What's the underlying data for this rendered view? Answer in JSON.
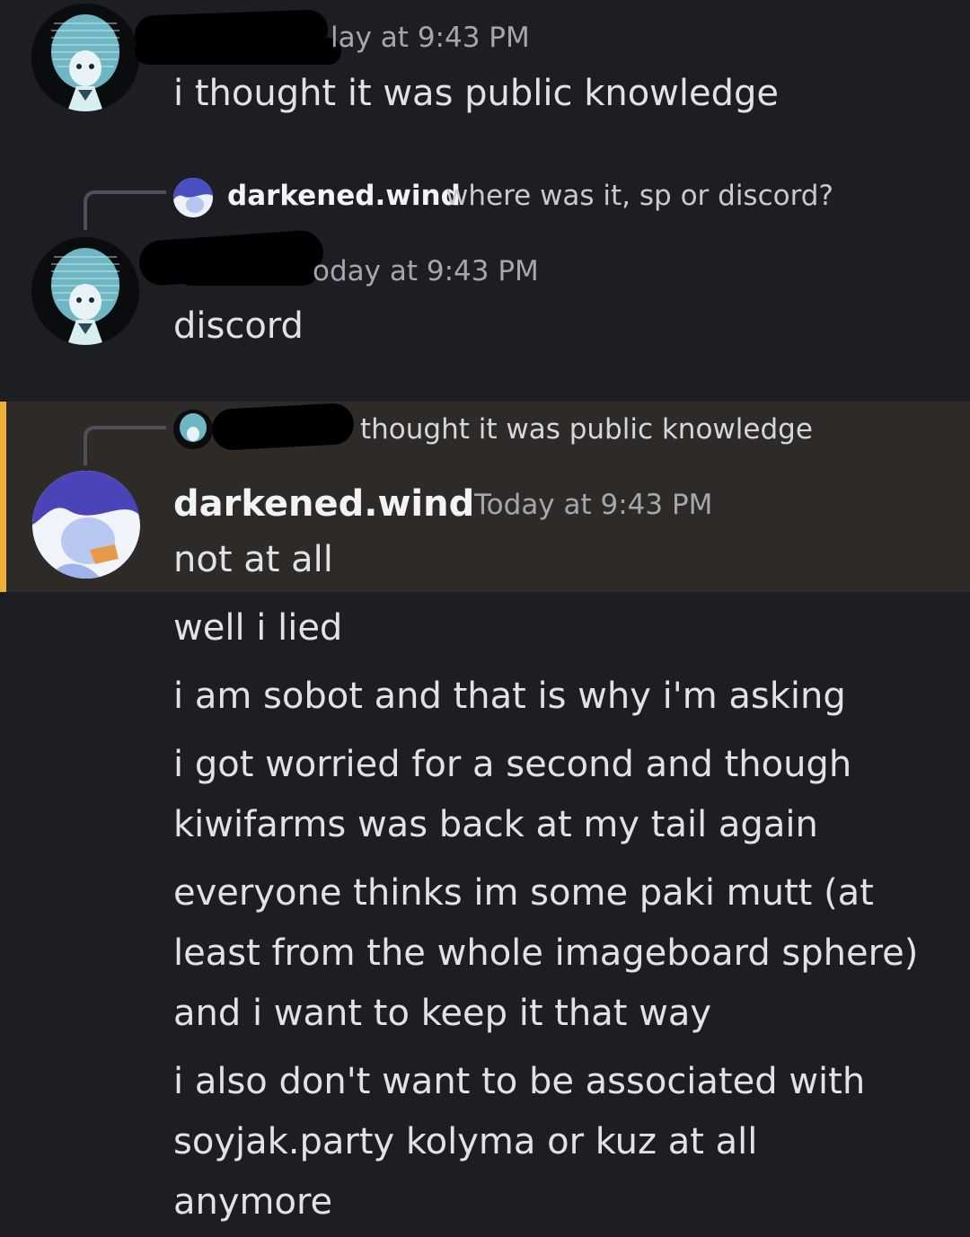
{
  "messages": [
    {
      "timestamp_partial": "lay at 9:43 PM",
      "text": "i thought it was public knowledge"
    },
    {
      "reply_to": {
        "username": "darkened.wind",
        "text": "where was it, sp or discord?"
      },
      "timestamp_partial": "oday at 9:43 PM",
      "text": "discord"
    },
    {
      "reply_to": {
        "text_partial": "thought it was public knowledge"
      },
      "username": "darkened.wind",
      "timestamp": "Today at 9:43 PM",
      "text": "not at all"
    }
  ],
  "followups": [
    {
      "lines": [
        "well i lied"
      ]
    },
    {
      "lines": [
        "i am sobot and that is why i'm asking"
      ]
    },
    {
      "lines": [
        "i got worried for a second and though",
        "kiwifarms was back at my tail again"
      ]
    },
    {
      "lines": [
        "everyone thinks im some paki mutt (at",
        "least from the whole imageboard sphere)",
        "and i want to keep it that way"
      ]
    },
    {
      "lines": [
        "i also don't want to be associated with",
        "soyjak.party kolyma or kuz at all",
        "anymore"
      ]
    }
  ],
  "colors": {
    "background": "#1d1e23",
    "highlight": "#2d2a28",
    "mention_bar": "#f0b132",
    "text": "#e1e2e6",
    "muted": "#a6a7ad"
  }
}
